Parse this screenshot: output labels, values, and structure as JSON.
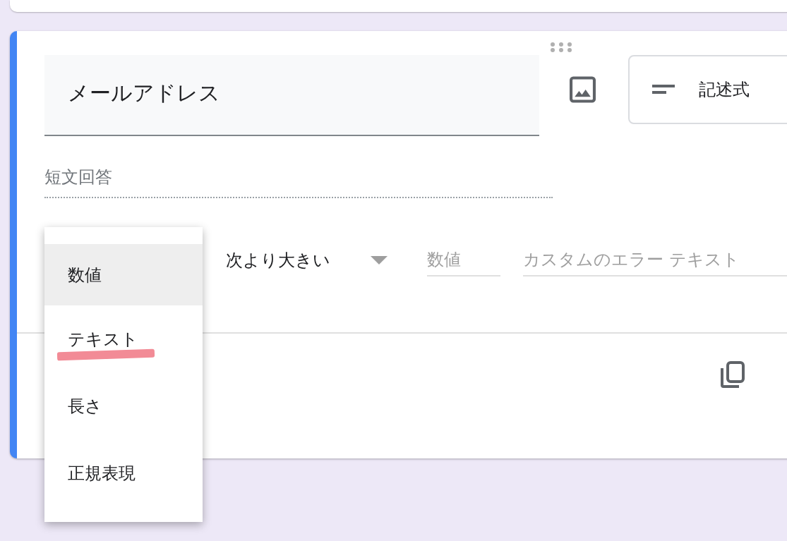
{
  "question": {
    "title": "メールアドレス",
    "type_selector": "記述式",
    "answer_placeholder": "短文回答"
  },
  "validation": {
    "condition": "次より大きい",
    "value_placeholder": "数値",
    "error_placeholder": "カスタムのエラー テキスト"
  },
  "menu": [
    {
      "label": "数値",
      "selected": true,
      "highlighted": false
    },
    {
      "label": "テキスト",
      "selected": false,
      "highlighted": true
    },
    {
      "label": "長さ",
      "selected": false,
      "highlighted": false
    },
    {
      "label": "正規表現",
      "selected": false,
      "highlighted": false
    }
  ]
}
